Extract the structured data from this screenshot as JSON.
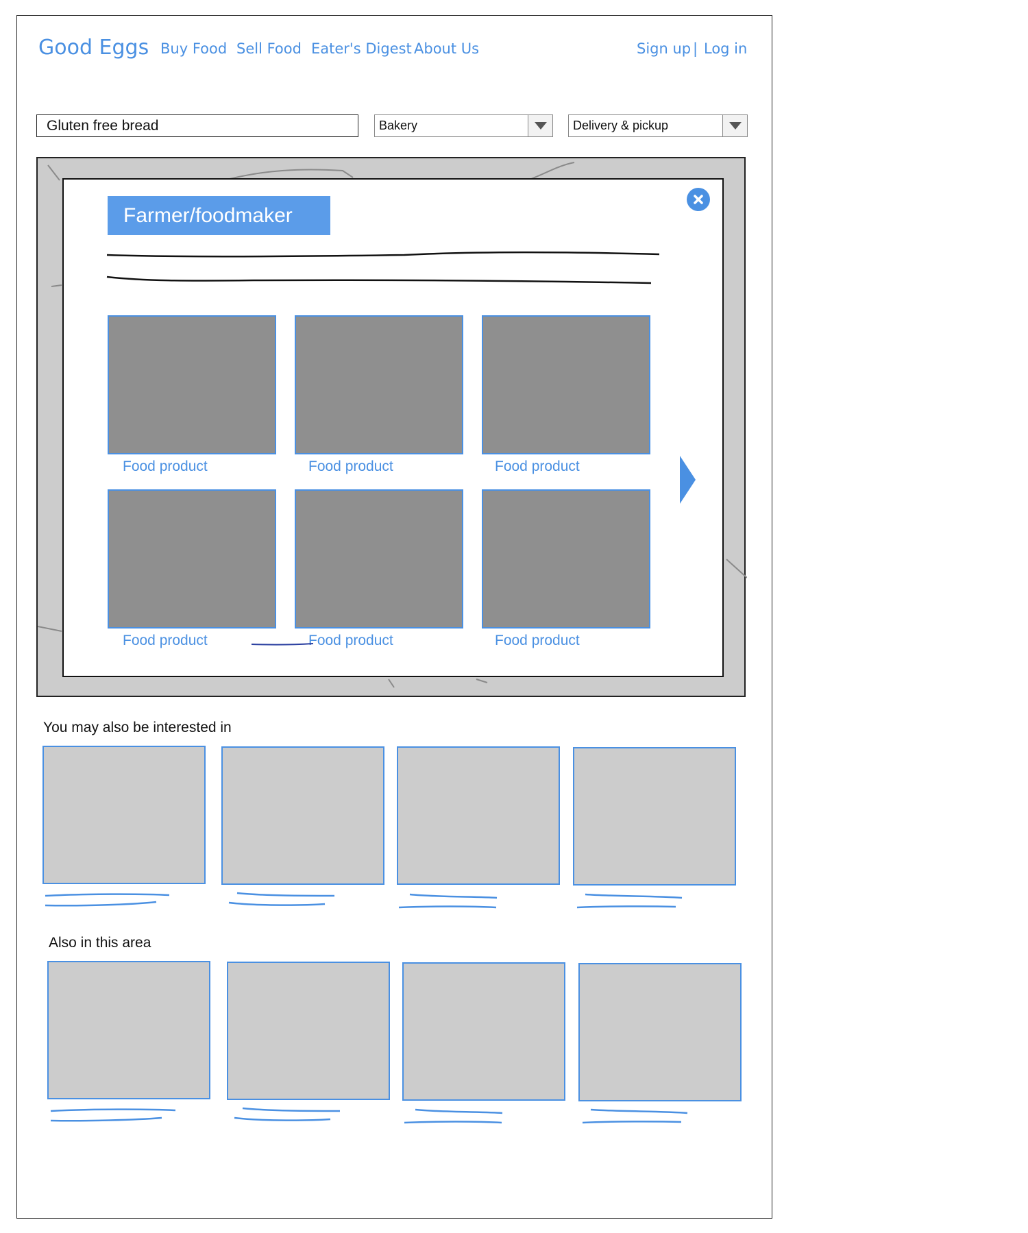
{
  "header": {
    "logo": "Good Eggs",
    "nav": [
      "Buy Food",
      "Sell Food",
      "Eater's Digest",
      "About Us"
    ],
    "sign_up": "Sign up",
    "separator": "|",
    "log_in": "Log in"
  },
  "search": {
    "query": "Gluten free bread",
    "category": "Bakery",
    "fulfillment": "Delivery & pickup"
  },
  "modal": {
    "title": "Farmer/foodmaker",
    "products": [
      "Food product",
      "Food product",
      "Food product",
      "Food product",
      "Food product",
      "Food product"
    ]
  },
  "sections": {
    "interested_heading": "You may also be interested in",
    "area_heading": "Also in this area"
  },
  "colors": {
    "accent": "#4a90e2",
    "tile_dark": "#8f8f8f",
    "tile_light": "#cccccc"
  }
}
